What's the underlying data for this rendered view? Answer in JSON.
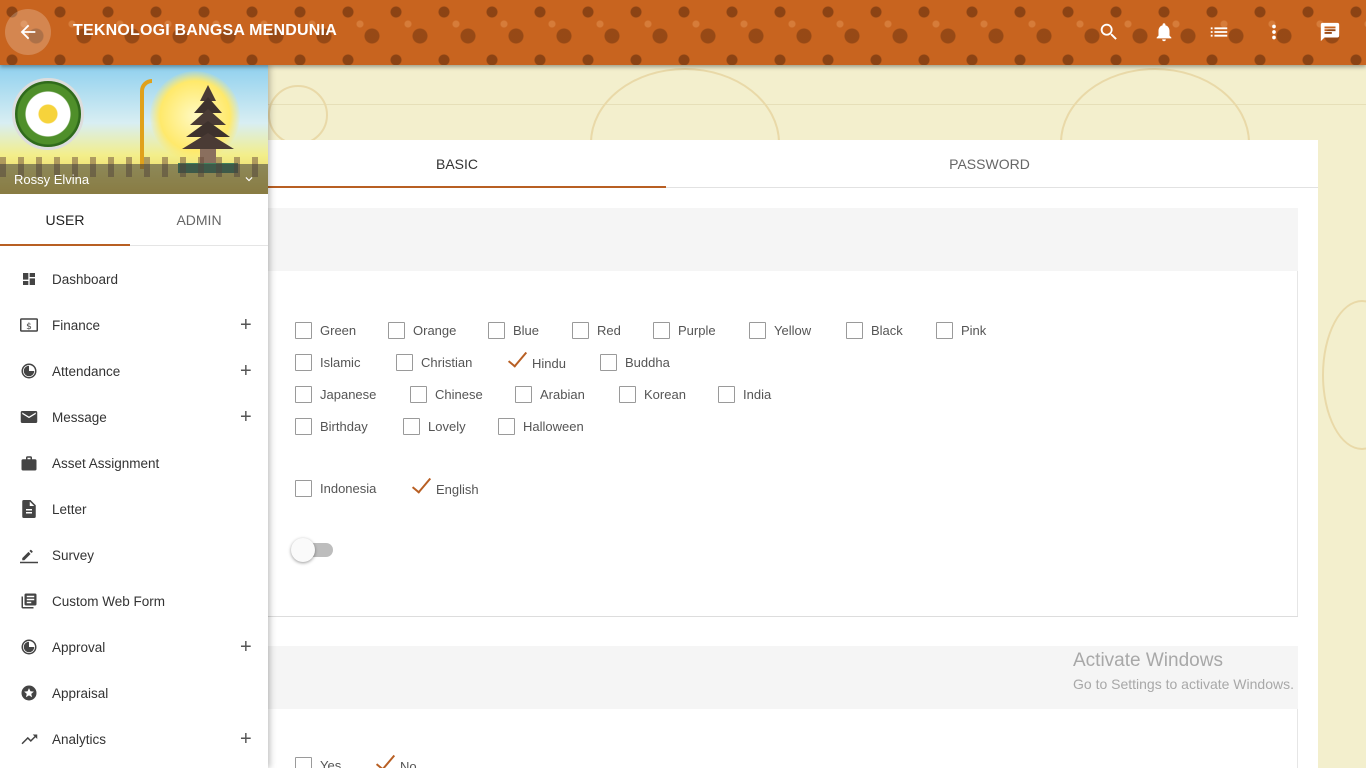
{
  "app": {
    "title": "TEKNOLOGI BANGSA MENDUNIA",
    "accent": "#b85f23",
    "header_color": "#c8641f"
  },
  "topbar_icons": [
    "back-arrow-icon",
    "search-icon",
    "bell-icon",
    "list-icon",
    "more-vert-icon",
    "chat-icon"
  ],
  "profile": {
    "name": "Rossy Elvina"
  },
  "side_tabs": [
    {
      "label": "USER",
      "active": true
    },
    {
      "label": "ADMIN",
      "active": false
    }
  ],
  "menu": [
    {
      "label": "Dashboard",
      "icon": "dashboard-icon",
      "expandable": false,
      "plus": ""
    },
    {
      "label": "Finance",
      "icon": "finance-icon",
      "expandable": true,
      "plus": "+"
    },
    {
      "label": "Attendance",
      "icon": "attendance-icon",
      "expandable": true,
      "plus": "+"
    },
    {
      "label": "Message",
      "icon": "mail-icon",
      "expandable": true,
      "plus": "+"
    },
    {
      "label": "Asset Assignment",
      "icon": "briefcase-icon",
      "expandable": false,
      "plus": ""
    },
    {
      "label": "Letter",
      "icon": "document-icon",
      "expandable": false,
      "plus": ""
    },
    {
      "label": "Survey",
      "icon": "pencil-icon",
      "expandable": false,
      "plus": ""
    },
    {
      "label": "Custom Web Form",
      "icon": "form-icon",
      "expandable": false,
      "plus": ""
    },
    {
      "label": "Approval",
      "icon": "approval-icon",
      "expandable": true,
      "plus": "+"
    },
    {
      "label": "Appraisal",
      "icon": "star-icon",
      "expandable": false,
      "plus": ""
    },
    {
      "label": "Analytics",
      "icon": "trending-icon",
      "expandable": true,
      "plus": "+"
    }
  ],
  "main_tabs": [
    {
      "label": "BASIC",
      "active": true
    },
    {
      "label": "PASSWORD",
      "active": false
    }
  ],
  "theme_rows": [
    [
      {
        "label": "Green",
        "checked": false
      },
      {
        "label": "Orange",
        "checked": false
      },
      {
        "label": "Blue",
        "checked": false
      },
      {
        "label": "Red",
        "checked": false
      },
      {
        "label": "Purple",
        "checked": false
      },
      {
        "label": "Yellow",
        "checked": false
      },
      {
        "label": "Black",
        "checked": false
      },
      {
        "label": "Pink",
        "checked": false
      }
    ],
    [
      {
        "label": "Islamic",
        "checked": false
      },
      {
        "label": "Christian",
        "checked": false
      },
      {
        "label": "Hindu",
        "checked": true
      },
      {
        "label": "Buddha",
        "checked": false
      }
    ],
    [
      {
        "label": "Japanese",
        "checked": false
      },
      {
        "label": "Chinese",
        "checked": false
      },
      {
        "label": "Arabian",
        "checked": false
      },
      {
        "label": "Korean",
        "checked": false
      },
      {
        "label": "India",
        "checked": false
      }
    ],
    [
      {
        "label": "Birthday",
        "checked": false
      },
      {
        "label": "Lovely",
        "checked": false
      },
      {
        "label": "Halloween",
        "checked": false
      }
    ]
  ],
  "language_options": [
    {
      "label": "Indonesia",
      "checked": false
    },
    {
      "label": "English",
      "checked": true
    }
  ],
  "toggle": {
    "on": false
  },
  "yes_no_options": [
    {
      "label": "Yes",
      "checked": false
    },
    {
      "label": "No",
      "checked": true
    }
  ],
  "watermark": {
    "line1": "Activate Windows",
    "line2": "Go to Settings to activate Windows."
  }
}
